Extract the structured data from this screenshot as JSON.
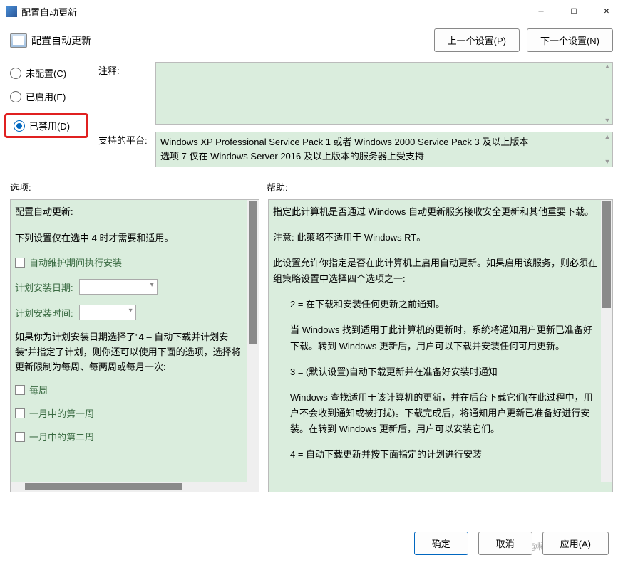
{
  "titlebar": {
    "title": "配置自动更新"
  },
  "header": {
    "title": "配置自动更新",
    "prev": "上一个设置(P)",
    "next": "下一个设置(N)"
  },
  "annotation": {
    "note_label": "注释:",
    "platform_label": "支持的平台:",
    "platform_text": "Windows XP Professional Service Pack 1 或者 Windows 2000 Service Pack 3 及以上版本\n选项 7 仅在 Windows Server 2016 及以上版本的服务器上受支持"
  },
  "state": {
    "not_configured": "未配置(C)",
    "enabled": "已启用(E)",
    "disabled": "已禁用(D)",
    "selected": "disabled"
  },
  "sections": {
    "options": "选项:",
    "help": "帮助:"
  },
  "options": {
    "title": "配置自动更新:",
    "note": "下列设置仅在选中 4 时才需要和适用。",
    "maintenance": "自动维护期间执行安装",
    "sched_date": "计划安装日期:",
    "sched_time": "计划安装时间:",
    "plan_para": "如果你为计划安装日期选择了\"4 – 自动下载并计划安装\"并指定了计划，则你还可以使用下面的选项，选择将更新限制为每周、每两周或每月一次:",
    "weekly": "每周",
    "first_week": "一月中的第一周",
    "second_week": "一月中的第二周"
  },
  "help": {
    "p1": "指定此计算机是否通过 Windows 自动更新服务接收安全更新和其他重要下载。",
    "p2": "注意: 此策略不适用于 Windows RT。",
    "p3": "此设置允许你指定是否在此计算机上启用自动更新。如果启用该服务，则必须在组策略设置中选择四个选项之一:",
    "p4": "2 = 在下载和安装任何更新之前通知。",
    "p5": "当 Windows 找到适用于此计算机的更新时，系统将通知用户更新已准备好下载。转到 Windows 更新后，用户可以下载并安装任何可用更新。",
    "p6": "3 = (默认设置)自动下载更新并在准备好安装时通知",
    "p7": "Windows 查找适用于该计算机的更新，并在后台下载它们(在此过程中，用户不会收到通知或被打扰)。下载完成后，将通知用户更新已准备好进行安装。在转到 Windows 更新后，用户可以安装它们。",
    "p8": "4 = 自动下载更新并按下面指定的计划进行安装"
  },
  "footer": {
    "ok": "确定",
    "cancel": "取消",
    "apply": "应用(A)"
  },
  "watermark": "@稀土掘金技术社区"
}
